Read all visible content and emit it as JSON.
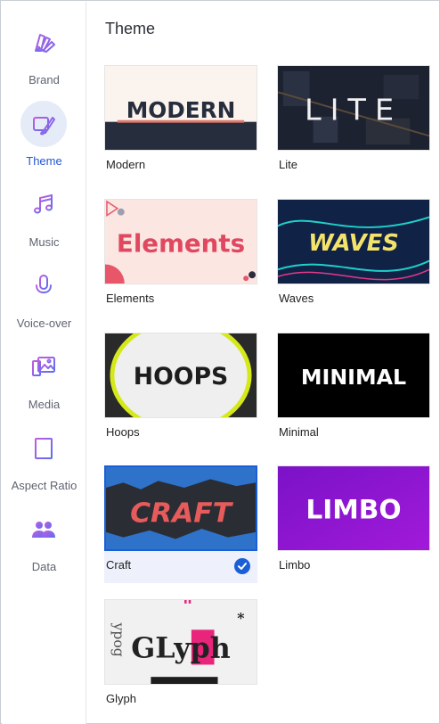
{
  "sidebar": {
    "items": [
      {
        "label": "Brand",
        "icon": "palette-swatches-icon"
      },
      {
        "label": "Theme",
        "icon": "theme-brush-icon",
        "active": true
      },
      {
        "label": "Music",
        "icon": "music-note-icon"
      },
      {
        "label": "Voice-over",
        "icon": "microphone-icon"
      },
      {
        "label": "Media",
        "icon": "media-images-icon"
      },
      {
        "label": "Aspect Ratio",
        "icon": "aspect-ratio-icon"
      },
      {
        "label": "Data",
        "icon": "people-data-icon"
      }
    ]
  },
  "main": {
    "title": "Theme",
    "themes": [
      {
        "label": "Modern",
        "thumb_text": "MODERN"
      },
      {
        "label": "Lite",
        "thumb_text": "LITE"
      },
      {
        "label": "Elements",
        "thumb_text": "Elements"
      },
      {
        "label": "Waves",
        "thumb_text": "WAVES"
      },
      {
        "label": "Hoops",
        "thumb_text": "HOOPS"
      },
      {
        "label": "Minimal",
        "thumb_text": "MINIMAL"
      },
      {
        "label": "Craft",
        "thumb_text": "CRAFT",
        "selected": true
      },
      {
        "label": "Limbo",
        "thumb_text": "LIMBO"
      },
      {
        "label": "Glyph",
        "thumb_text": "GLyph"
      }
    ],
    "selected_theme": "Craft"
  },
  "colors": {
    "accent": "#2457d6",
    "icon_gradient_start": "#c45be0",
    "icon_gradient_end": "#5a6ff0",
    "active_bg": "#e6ebf8"
  }
}
